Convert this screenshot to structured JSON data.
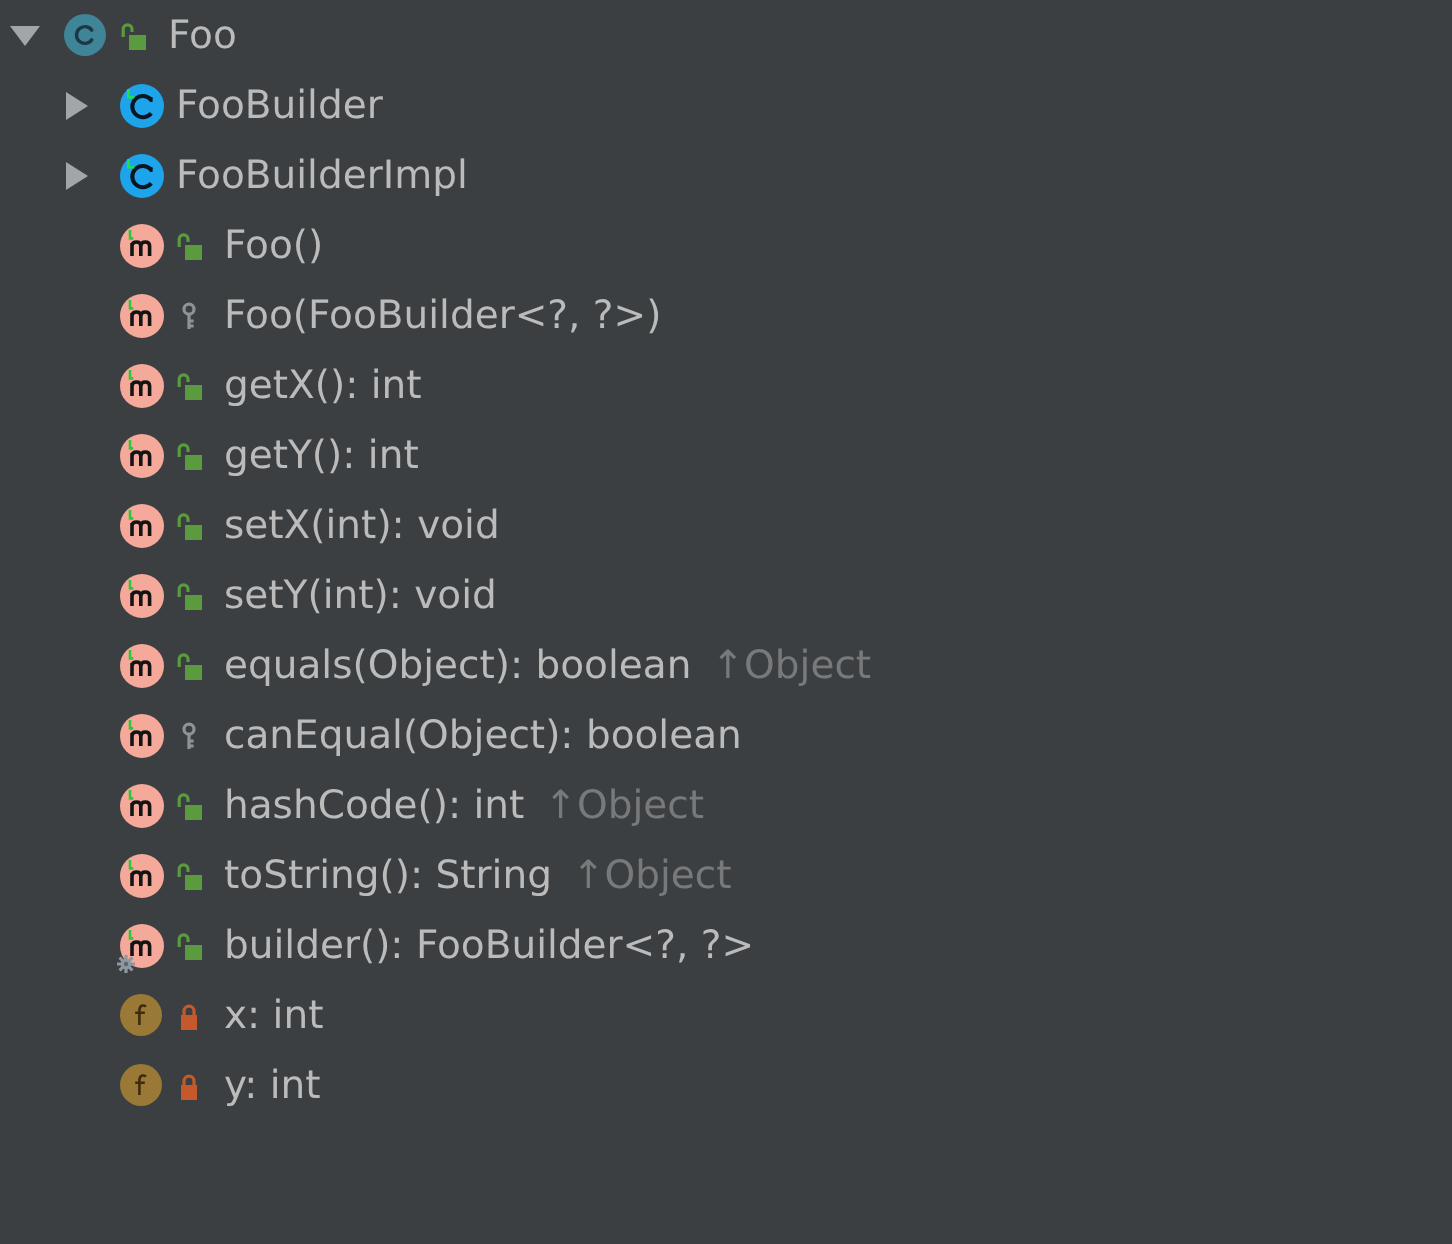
{
  "tree": {
    "label": "Foo",
    "kind": "class",
    "access": {
      "kind": "public"
    },
    "expanded": true,
    "children": [
      {
        "label": "FooBuilder",
        "kind": "generated-class",
        "expanded": false
      },
      {
        "label": "FooBuilderImpl",
        "kind": "generated-class",
        "expanded": false
      },
      {
        "label": "Foo()",
        "kind": "method",
        "access": {
          "kind": "public"
        },
        "static": false
      },
      {
        "label": "Foo(FooBuilder<?, ?>)",
        "kind": "method",
        "access": {
          "kind": "protected"
        },
        "static": false
      },
      {
        "label": "getX(): int",
        "kind": "method",
        "access": {
          "kind": "public"
        },
        "static": false
      },
      {
        "label": "getY(): int",
        "kind": "method",
        "access": {
          "kind": "public"
        },
        "static": false
      },
      {
        "label": "setX(int): void",
        "kind": "method",
        "access": {
          "kind": "public"
        },
        "static": false
      },
      {
        "label": "setY(int): void",
        "kind": "method",
        "access": {
          "kind": "public"
        },
        "static": false
      },
      {
        "label": "equals(Object): boolean",
        "suffix": "↑Object",
        "kind": "method",
        "access": {
          "kind": "public"
        },
        "static": false
      },
      {
        "label": "canEqual(Object): boolean",
        "kind": "method",
        "access": {
          "kind": "protected"
        },
        "static": false
      },
      {
        "label": "hashCode(): int",
        "suffix": "↑Object",
        "kind": "method",
        "access": {
          "kind": "public"
        },
        "static": false
      },
      {
        "label": "toString(): String",
        "suffix": "↑Object",
        "kind": "method",
        "access": {
          "kind": "public"
        },
        "static": false
      },
      {
        "label": "builder(): FooBuilder<?, ?>",
        "kind": "method",
        "access": {
          "kind": "public"
        },
        "static": true
      },
      {
        "label": "x: int",
        "kind": "field",
        "access": {
          "kind": "private"
        },
        "static": false
      },
      {
        "label": "y: int",
        "kind": "field",
        "access": {
          "kind": "private"
        },
        "static": false
      }
    ]
  }
}
